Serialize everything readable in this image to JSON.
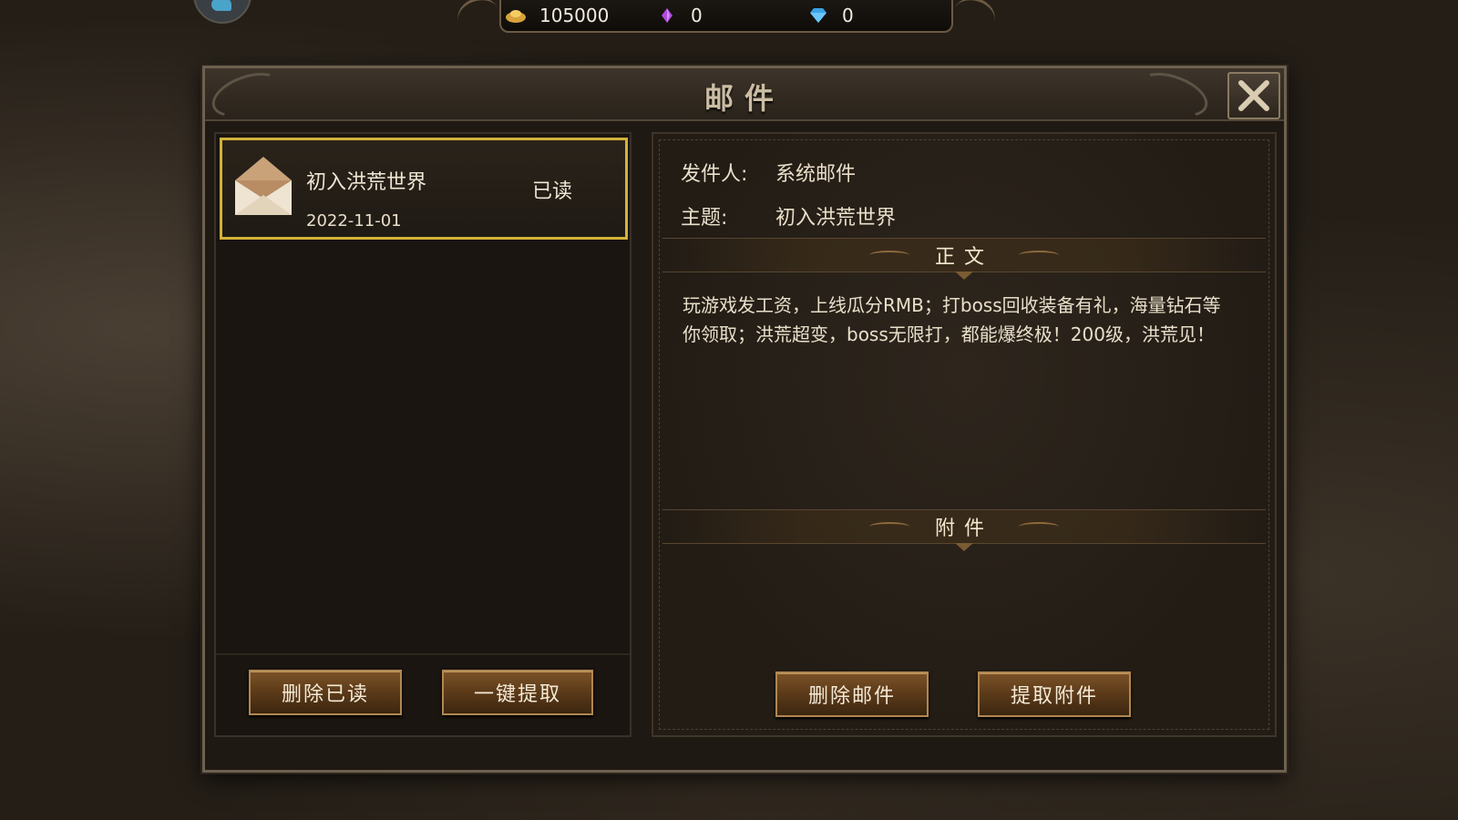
{
  "currency": {
    "gold": "105000",
    "crystal": "0",
    "diamond": "0"
  },
  "window": {
    "title": "邮件"
  },
  "mail_list": {
    "items": [
      {
        "subject": "初入洪荒世界",
        "date": "2022-11-01",
        "status": "已读"
      }
    ],
    "delete_read_label": "删除已读",
    "claim_all_label": "一键提取"
  },
  "detail": {
    "sender_label": "发件人:",
    "sender_value": "系统邮件",
    "subject_label": "主题:",
    "subject_value": "初入洪荒世界",
    "body_header": "正文",
    "body_text": "玩游戏发工资，上线瓜分RMB；打boss回收装备有礼，海量钻石等你领取；洪荒超变，boss无限打，都能爆终极！200级，洪荒见！",
    "attachment_header": "附件",
    "delete_mail_label": "删除邮件",
    "claim_attachment_label": "提取附件"
  },
  "colors": {
    "selected_border": "#d4b23a",
    "button_brown": "#5e3c1a",
    "text_light": "#efe6d4"
  }
}
